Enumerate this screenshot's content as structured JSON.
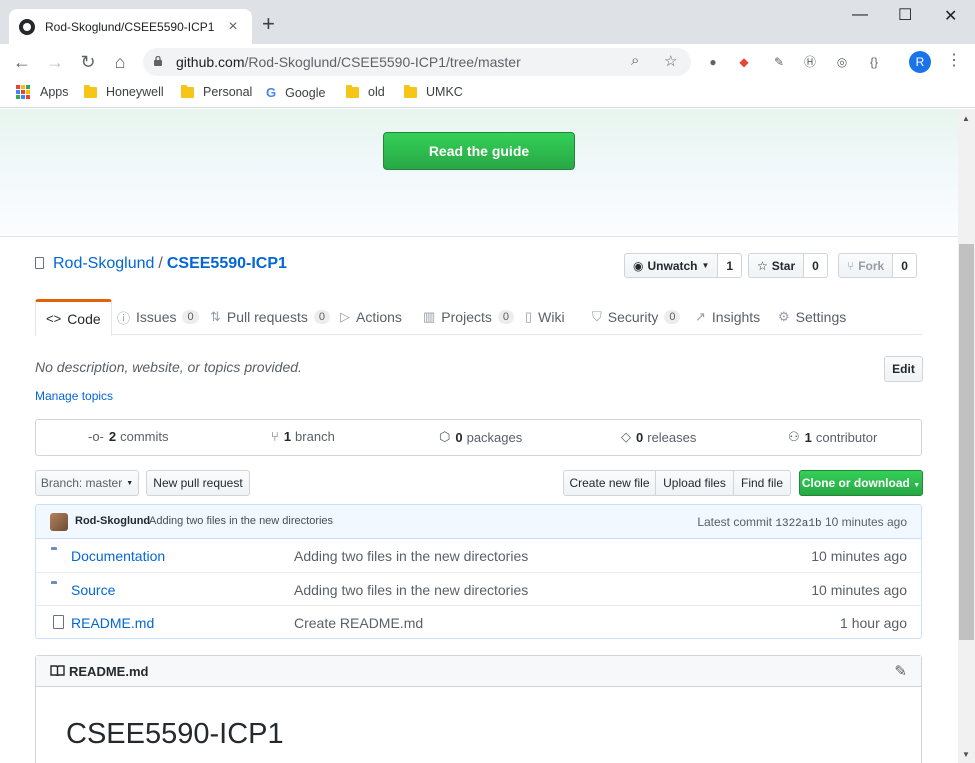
{
  "browser": {
    "tab_title": "Rod-Skoglund/CSEE5590-ICP1",
    "url_host": "github.com",
    "url_path": "/Rod-Skoglund/CSEE5590-ICP1/tree/master",
    "profile_initial": "R",
    "bookmarks": [
      "Apps",
      "Honeywell",
      "Personal",
      "Google",
      "old",
      "UMKC"
    ]
  },
  "hero": {
    "guide_button": "Read the guide"
  },
  "repo": {
    "owner": "Rod-Skoglund",
    "name": "CSEE5590-ICP1",
    "unwatch_label": "Unwatch",
    "watch_count": "1",
    "star_label": "Star",
    "star_count": "0",
    "fork_label": "Fork",
    "fork_count": "0"
  },
  "nav": {
    "tabs": [
      {
        "label": "Code"
      },
      {
        "label": "Issues",
        "count": "0"
      },
      {
        "label": "Pull requests",
        "count": "0"
      },
      {
        "label": "Actions"
      },
      {
        "label": "Projects",
        "count": "0"
      },
      {
        "label": "Wiki"
      },
      {
        "label": "Security",
        "count": "0"
      },
      {
        "label": "Insights"
      },
      {
        "label": "Settings"
      }
    ]
  },
  "about": {
    "description": "No description, website, or topics provided.",
    "manage_topics": "Manage topics",
    "edit_label": "Edit"
  },
  "summary": [
    {
      "count": "2",
      "label": "commits"
    },
    {
      "count": "1",
      "label": "branch"
    },
    {
      "count": "0",
      "label": "packages"
    },
    {
      "count": "0",
      "label": "releases"
    },
    {
      "count": "1",
      "label": "contributor"
    }
  ],
  "filebar": {
    "branch_label": "Branch: master",
    "new_pr": "New pull request",
    "create_file": "Create new file",
    "upload_files": "Upload files",
    "find_file": "Find file",
    "clone": "Clone or download"
  },
  "latest_commit": {
    "author": "Rod-Skoglund",
    "message": "Adding two files in the new directories",
    "prefix": "Latest commit",
    "sha": "1322a1b",
    "age": "10 minutes ago"
  },
  "files": [
    {
      "name": "Documentation",
      "type": "dir",
      "message": "Adding two files in the new directories",
      "age": "10 minutes ago"
    },
    {
      "name": "Source",
      "type": "dir",
      "message": "Adding two files in the new directories",
      "age": "10 minutes ago"
    },
    {
      "name": "README.md",
      "type": "file",
      "message": "Create README.md",
      "age": "1 hour ago"
    }
  ],
  "readme": {
    "filename": "README.md",
    "heading": "CSEE5590-ICP1"
  }
}
